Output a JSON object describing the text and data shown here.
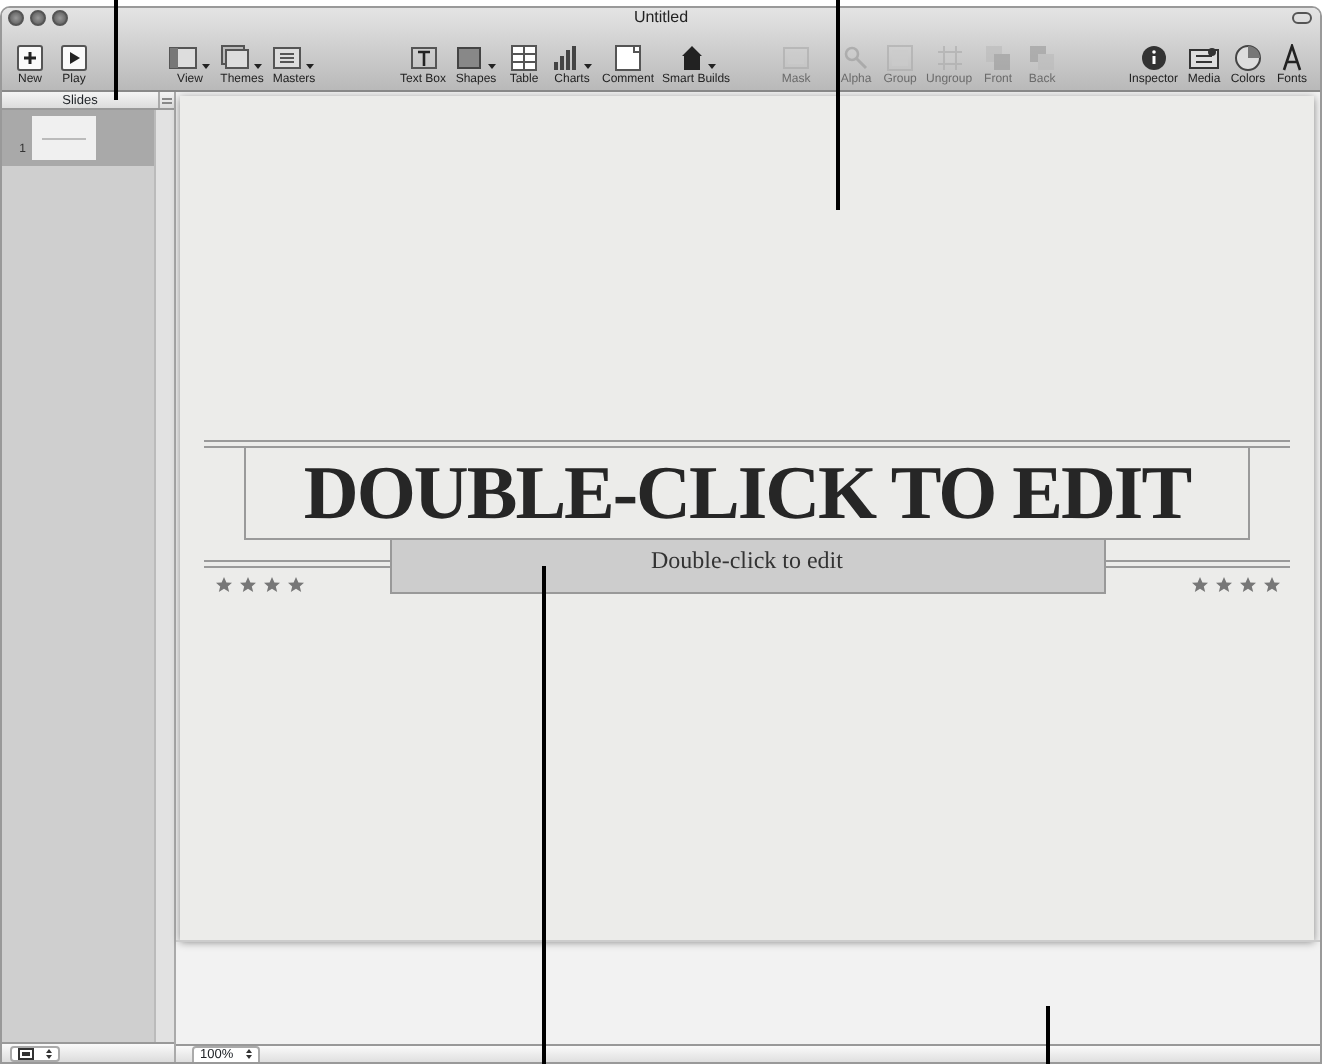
{
  "window": {
    "title": "Untitled"
  },
  "toolbar": {
    "groups": [
      [
        {
          "label": "New",
          "disabled": false,
          "menu": false
        },
        {
          "label": "Play",
          "disabled": false,
          "menu": false
        }
      ],
      [
        {
          "label": "View",
          "disabled": false,
          "menu": true
        },
        {
          "label": "Themes",
          "disabled": false,
          "menu": true
        },
        {
          "label": "Masters",
          "disabled": false,
          "menu": true
        }
      ],
      [
        {
          "label": "Text Box",
          "disabled": false,
          "menu": false
        },
        {
          "label": "Shapes",
          "disabled": false,
          "menu": true
        },
        {
          "label": "Table",
          "disabled": false,
          "menu": false
        },
        {
          "label": "Charts",
          "disabled": false,
          "menu": true
        },
        {
          "label": "Comment",
          "disabled": false,
          "menu": false
        },
        {
          "label": "Smart Builds",
          "disabled": false,
          "menu": true
        }
      ],
      [
        {
          "label": "Mask",
          "disabled": true,
          "menu": false
        }
      ],
      [
        {
          "label": "Alpha",
          "disabled": true,
          "menu": false
        },
        {
          "label": "Group",
          "disabled": true,
          "menu": false
        },
        {
          "label": "Ungroup",
          "disabled": true,
          "menu": false
        },
        {
          "label": "Front",
          "disabled": true,
          "menu": false
        },
        {
          "label": "Back",
          "disabled": true,
          "menu": false
        }
      ],
      [
        {
          "label": "Inspector",
          "disabled": false,
          "menu": false
        },
        {
          "label": "Media",
          "disabled": false,
          "menu": false
        },
        {
          "label": "Colors",
          "disabled": false,
          "menu": false
        },
        {
          "label": "Fonts",
          "disabled": false,
          "menu": false
        }
      ]
    ]
  },
  "slides_panel": {
    "header": "Slides",
    "slides": [
      {
        "number": "1",
        "selected": true
      }
    ]
  },
  "slide": {
    "title": "DOUBLE-CLICK TO EDIT",
    "subtitle": "Double-click to edit"
  },
  "status_bar": {
    "zoom": "100%"
  }
}
